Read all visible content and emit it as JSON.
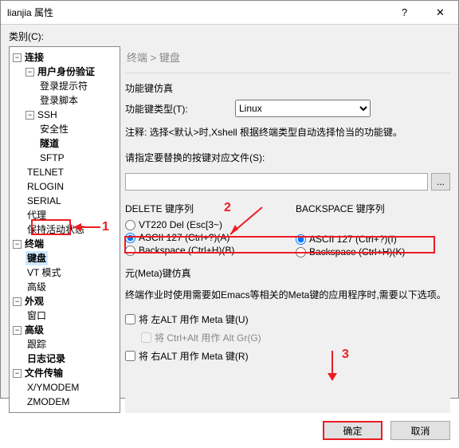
{
  "window": {
    "title": "lianjia 属性",
    "help": "?",
    "close": "✕"
  },
  "category_label": "类别(C):",
  "tree": {
    "conn": "连接",
    "userauth": "用户身份验证",
    "loginprompt": "登录提示符",
    "loginscript": "登录脚本",
    "ssh": "SSH",
    "security": "安全性",
    "tunnel": "隧道",
    "sftp": "SFTP",
    "telnet": "TELNET",
    "rlogin": "RLOGIN",
    "serial": "SERIAL",
    "proxy": "代理",
    "keepalive": "保持活动状态",
    "terminal": "终端",
    "keyboard": "键盘",
    "vtmode": "VT 模式",
    "advanced": "高级",
    "appearance": "外观",
    "window": "窗口",
    "advanced2": "高级",
    "tracking": "跟踪",
    "logging": "日志记录",
    "filetransfer": "文件传输",
    "xymodem": "X/YMODEM",
    "zmodem": "ZMODEM"
  },
  "breadcrumb": "终端 > 键盘",
  "section1": {
    "title": "功能键仿真",
    "type_label": "功能键类型(T):",
    "type_value": "Linux",
    "hint": "注释: 选择<默认>时,Xshell 根据终端类型自动选择恰当的功能键。"
  },
  "section2": {
    "label": "请指定要替换的按键对应文件(S):",
    "browse": "..."
  },
  "delete": {
    "title": "DELETE 键序列",
    "opt1": "VT220 Del (Esc[3~)",
    "opt2": "ASCII 127 (Ctrl+?)(A)",
    "opt3": "Backspace (Ctrl+H)(B)"
  },
  "backspace": {
    "title": "BACKSPACE 键序列",
    "opt1": "ASCII 127 (Ctrl+?)(I)",
    "opt2": "Backspace (Ctrl+H)(K)"
  },
  "meta": {
    "title": "元(Meta)键仿真",
    "desc": "终端作业时使用需要如Emacs等相关的Meta键的应用程序时,需要以下选项。",
    "chk1": "将 左ALT 用作 Meta 键(U)",
    "chk2": "将 Ctrl+Alt 用作 Alt Gr(G)",
    "chk3": "将 右ALT 用作 Meta 键(R)"
  },
  "buttons": {
    "ok": "确定",
    "cancel": "取消"
  },
  "anno": {
    "a1": "1",
    "a2": "2",
    "a3": "3"
  }
}
